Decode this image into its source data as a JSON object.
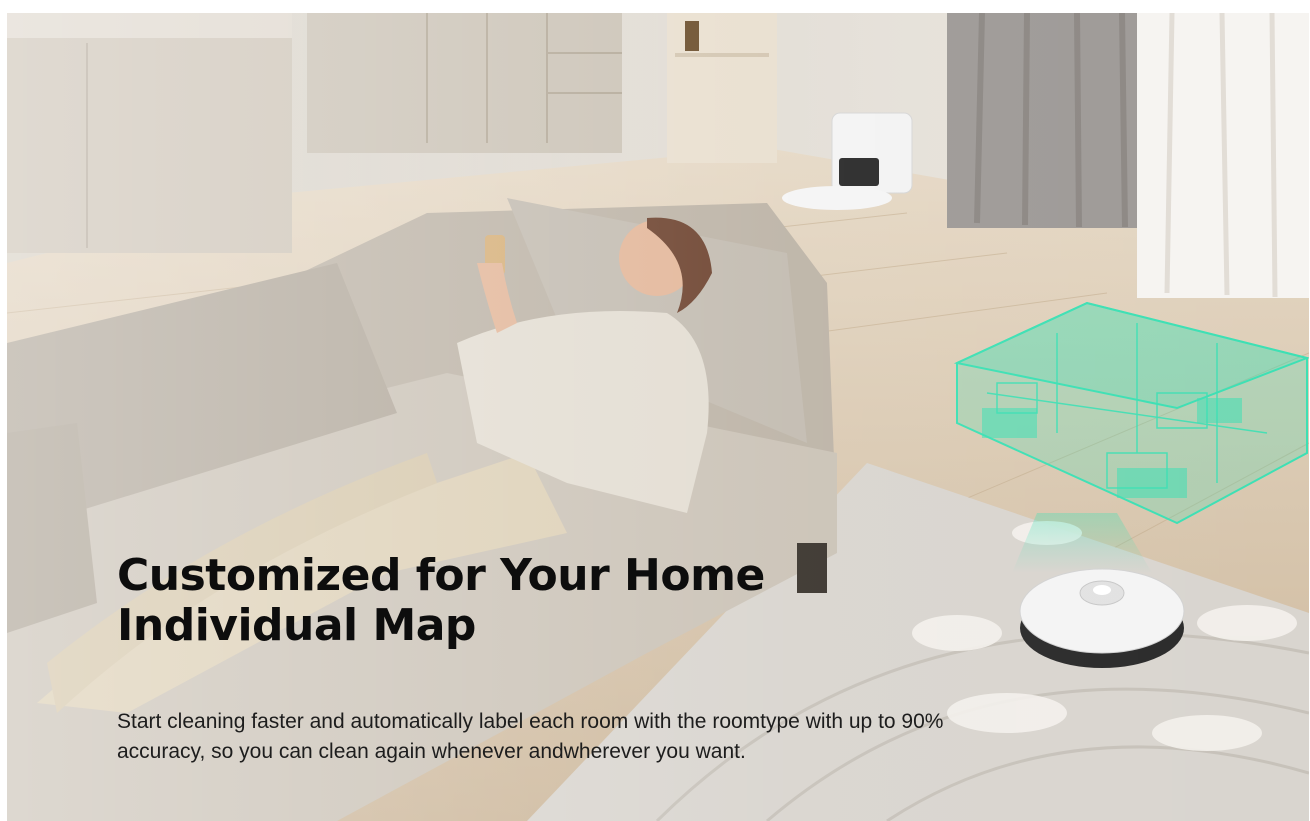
{
  "hero": {
    "headline_line1": "Customized for Your Home",
    "headline_line2": "Individual Map",
    "description": "Start cleaning faster and automatically label each room with the roomtype with up to 90% accuracy, so you can clean again whenever andwherever you want."
  },
  "colors": {
    "map_hologram": "#3de0b4",
    "headline_text": "#0d0d0d",
    "body_text": "#1d1d1d"
  }
}
